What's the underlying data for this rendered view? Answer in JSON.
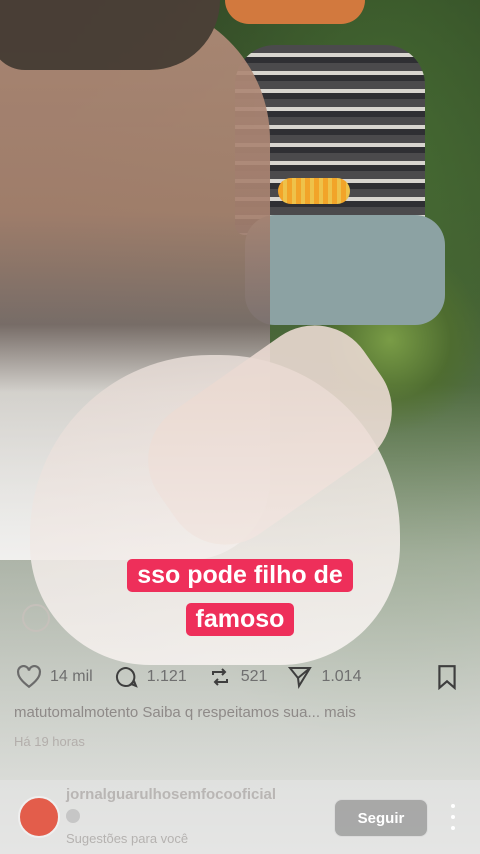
{
  "caption": {
    "line1": "sso pode filho de",
    "line2": "famoso"
  },
  "actions": {
    "likes": "14 mil",
    "comments": "1.121",
    "reposts": "521",
    "shares": "1.014"
  },
  "post": {
    "description": "matutomalmotento Saiba q respeitamos sua... mais",
    "time": "Há 19 horas"
  },
  "suggestion": {
    "account": "jornalguarulhosemfocooficial",
    "label": "Sugestões para você",
    "follow_label": "Seguir"
  },
  "colors": {
    "caption_bg": "#ee2f5a"
  }
}
